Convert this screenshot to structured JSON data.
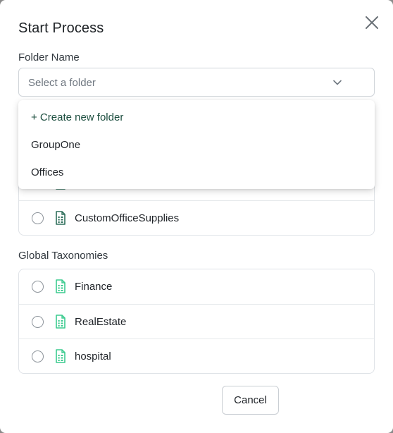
{
  "dialog": {
    "title": "Start Process",
    "folder_label": "Folder Name",
    "folder_placeholder": "Select a folder"
  },
  "dropdown": {
    "create_label": "+ Create new folder",
    "options": [
      "GroupOne",
      "Offices"
    ]
  },
  "custom_taxonomies": {
    "items": [
      "CustomOfficeSupplies"
    ]
  },
  "global_taxonomies": {
    "label": "Global Taxonomies",
    "items": [
      "Finance",
      "RealEstate",
      "hospital"
    ]
  },
  "footer": {
    "cancel_label": "Cancel"
  },
  "icons": {
    "close": "close-icon",
    "chevron": "chevron-down-icon",
    "document": "spreadsheet-document-icon"
  },
  "colors": {
    "custom_icon": "#2f6f5b",
    "global_icon": "#3ccb8f",
    "create_link": "#1b4d3e"
  }
}
